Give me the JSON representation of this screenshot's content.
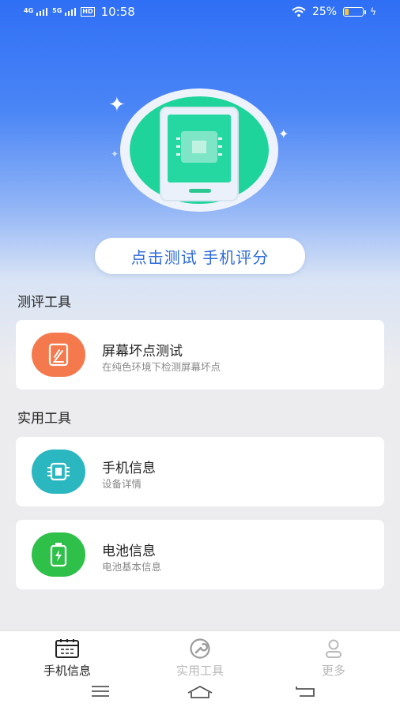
{
  "status_bar": {
    "net1": "4G",
    "net2": "5G",
    "hd": "HD",
    "time": "10:58",
    "battery_percent_text": "25%",
    "battery_level": 0.25,
    "battery_color": "#f6c431"
  },
  "hero": {
    "illustration_icon": "phone-chip-icon",
    "test_button_label": "点击测试 手机评分"
  },
  "sections": {
    "eval_title": "测评工具",
    "practical_title": "实用工具"
  },
  "cards": [
    {
      "title": "屏幕坏点测试",
      "subtitle": "在纯色环境下检测屏幕坏点",
      "icon": "screen-icon",
      "color": "#f47a4d"
    },
    {
      "title": "手机信息",
      "subtitle": "设备详情",
      "icon": "chip-icon",
      "color": "#2bb7c0"
    },
    {
      "title": "电池信息",
      "subtitle": "电池基本信息",
      "icon": "battery-icon",
      "color": "#2fc049"
    }
  ],
  "bottom_nav": {
    "tabs": [
      {
        "label": "手机信息",
        "icon": "phone-info-icon",
        "active": true
      },
      {
        "label": "实用工具",
        "icon": "wrench-icon",
        "active": false
      },
      {
        "label": "更多",
        "icon": "person-icon",
        "active": false
      }
    ],
    "active_color": "#222222",
    "inactive_color": "#b9b9b9"
  }
}
